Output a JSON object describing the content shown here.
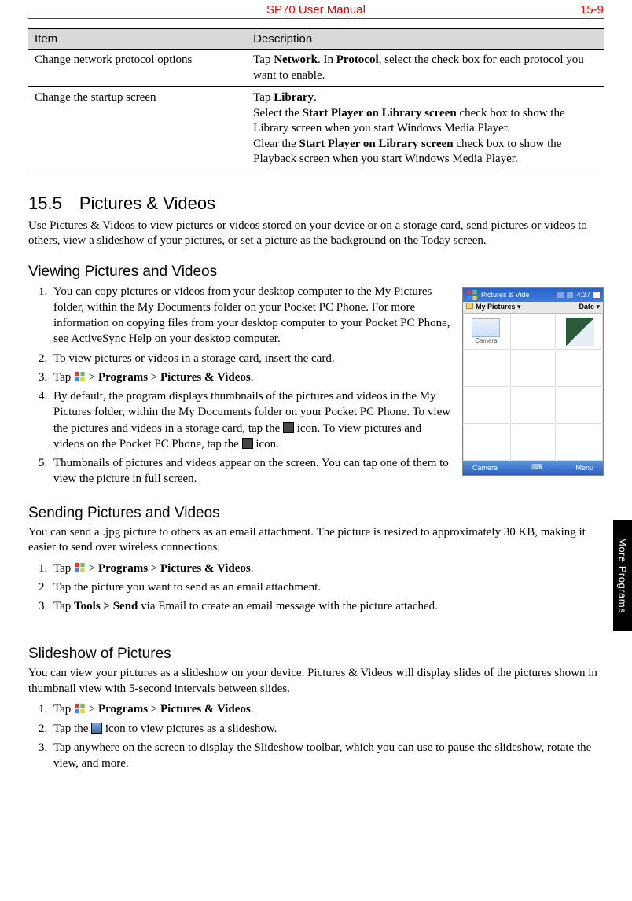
{
  "header": {
    "title": "SP70 User Manual",
    "page": "15-9"
  },
  "side_tab": "More Programs",
  "table": {
    "col_item": "Item",
    "col_desc": "Description",
    "rows": [
      {
        "item": "Change network protocol options",
        "desc_parts": [
          "Tap ",
          "Network",
          ". In ",
          "Protocol",
          ", select the check box for each protocol you want to enable."
        ]
      },
      {
        "item": "Change the startup screen",
        "desc_html": "Tap <b>Library</b>.<br>Select the <b>Start Player on Library screen</b> check box to show the Library screen when you start Windows Media Player.<br>Clear the <b>Start Player on Library screen</b> check box to show the Playback screen when you start Windows Media Player."
      }
    ]
  },
  "section_15_5": {
    "title": "15.5 Pictures & Videos",
    "intro": "Use Pictures & Videos to view pictures or videos stored on your device or on a storage card, send pictures or videos to others, view a slideshow of your pictures, or set a picture as the background on the Today screen."
  },
  "viewing": {
    "title": "Viewing Pictures and Videos",
    "steps": [
      "You can copy pictures or videos from your desktop computer to the My Pictures folder, within the My Documents folder on your Pocket PC Phone. For more information on copying files from your desktop computer to your Pocket PC Phone, see ActiveSync Help on your desktop computer.",
      "To view pictures or videos in a storage card, insert the card.",
      "Tap {START} > <b>Programs</b> > <b>Pictures & Videos</b>.",
      "By default, the program displays thumbnails of the pictures and videos in the My Pictures folder, within the My Documents folder on your Pocket PC Phone. To view the pictures and videos in a storage card, tap the {SD} icon. To view pictures and videos on the Pocket PC Phone, tap the {DEV} icon.",
      "Thumbnails of pictures and videos appear on the screen. You can tap one of them to view the picture in full screen."
    ]
  },
  "screenshot": {
    "title": "Pictures & Vide",
    "time": "4:37",
    "folder": "My Pictures",
    "sort": "Date",
    "thumb1_label": "Camera",
    "sk_left": "Camera",
    "sk_right": "Menu"
  },
  "sending": {
    "title": "Sending Pictures and Videos",
    "intro": "You can send a .jpg picture to others as an email attachment. The picture is resized to approximately 30 KB, making it easier to send over wireless connections.",
    "steps": [
      "Tap {START} > <b>Programs</b> > <b>Pictures & Videos</b>.",
      "Tap the picture you want to send as an email attachment.",
      "Tap <b>Tools > Send</b> via Email to create an email message with the picture attached."
    ]
  },
  "slideshow": {
    "title": "Slideshow of Pictures",
    "intro": "You can view your pictures as a slideshow on your device. Pictures & Videos will display slides of the pictures shown in thumbnail view with 5-second intervals between slides.",
    "steps": [
      "Tap {START} > <b>Programs</b> > <b>Pictures & Videos</b>.",
      "Tap the {SLIDE} icon to view pictures as a slideshow.",
      "Tap anywhere on the screen to display the Slideshow toolbar, which you can use to pause the slideshow, rotate the view, and more."
    ]
  }
}
